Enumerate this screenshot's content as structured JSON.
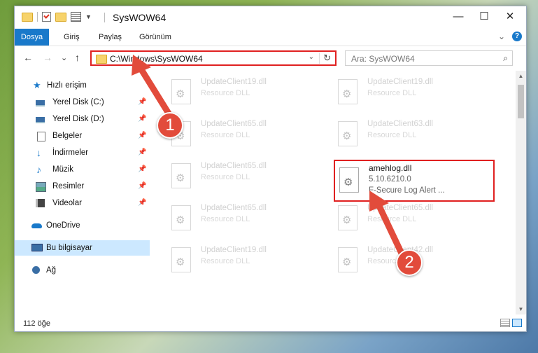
{
  "window": {
    "title": "SysWOW64",
    "controls": {
      "minimize": "—",
      "maximize": "☐",
      "close": "✕"
    }
  },
  "ribbon": {
    "tabs": [
      "Dosya",
      "Giriş",
      "Paylaş",
      "Görünüm"
    ],
    "expand_glyph": "⌄",
    "help_glyph": "?"
  },
  "nav": {
    "back": "←",
    "forward": "→",
    "recent": "⌄",
    "up": "↑",
    "address": "C:\\Windows\\SysWOW64",
    "address_dropdown": "⌄",
    "refresh": "↻",
    "search_placeholder": "Ara: SysWOW64",
    "search_icon": "⌕"
  },
  "sidebar": {
    "items": [
      {
        "label": "Hızlı erişim",
        "icon": "star-icon",
        "pinned": false
      },
      {
        "label": "Yerel Disk (C:)",
        "icon": "drive-icon",
        "pinned": true
      },
      {
        "label": "Yerel Disk (D:)",
        "icon": "drive-icon",
        "pinned": true
      },
      {
        "label": "Belgeler",
        "icon": "documents-icon",
        "pinned": true
      },
      {
        "label": "İndirmeler",
        "icon": "download-icon",
        "pinned": true
      },
      {
        "label": "Müzik",
        "icon": "music-icon",
        "pinned": true
      },
      {
        "label": "Resimler",
        "icon": "pictures-icon",
        "pinned": true
      },
      {
        "label": "Videolar",
        "icon": "videos-icon",
        "pinned": true
      },
      {
        "label": "OneDrive",
        "icon": "cloud-icon",
        "pinned": false
      },
      {
        "label": "Bu bilgisayar",
        "icon": "computer-icon",
        "pinned": false,
        "selected": true
      },
      {
        "label": "Ağ",
        "icon": "network-icon",
        "pinned": false
      }
    ],
    "pin_glyph": "📌"
  },
  "files": {
    "ghost": [
      {
        "name": "UpdateClient19.dll",
        "desc": "Resource DLL"
      },
      {
        "name": "UpdateClient19.dll",
        "desc": "Resource DLL"
      },
      {
        "name": "UpdateClient65.dll",
        "desc": "Resource DLL"
      },
      {
        "name": "UpdateClient63.dll",
        "desc": "Resource DLL"
      },
      {
        "name": "UpdateClient65.dll",
        "desc": "Resource DLL"
      },
      {
        "name": "UpdateClient65.dll",
        "desc": "Resource DLL"
      },
      {
        "name": "UpdateClient65.dll",
        "desc": "Resource DLL"
      },
      {
        "name": "UpdateClient19.dll",
        "desc": "Resource DLL"
      },
      {
        "name": "UpdateClient42.dll",
        "desc": "Resource DLL"
      }
    ],
    "highlighted": {
      "name": "amehlog.dll",
      "version": "5.10.6210.0",
      "description": "F-Secure Log Alert ..."
    }
  },
  "annotations": {
    "step1": "1",
    "step2": "2",
    "color": "#e24b3b"
  },
  "status": {
    "count": "112 öğe"
  }
}
